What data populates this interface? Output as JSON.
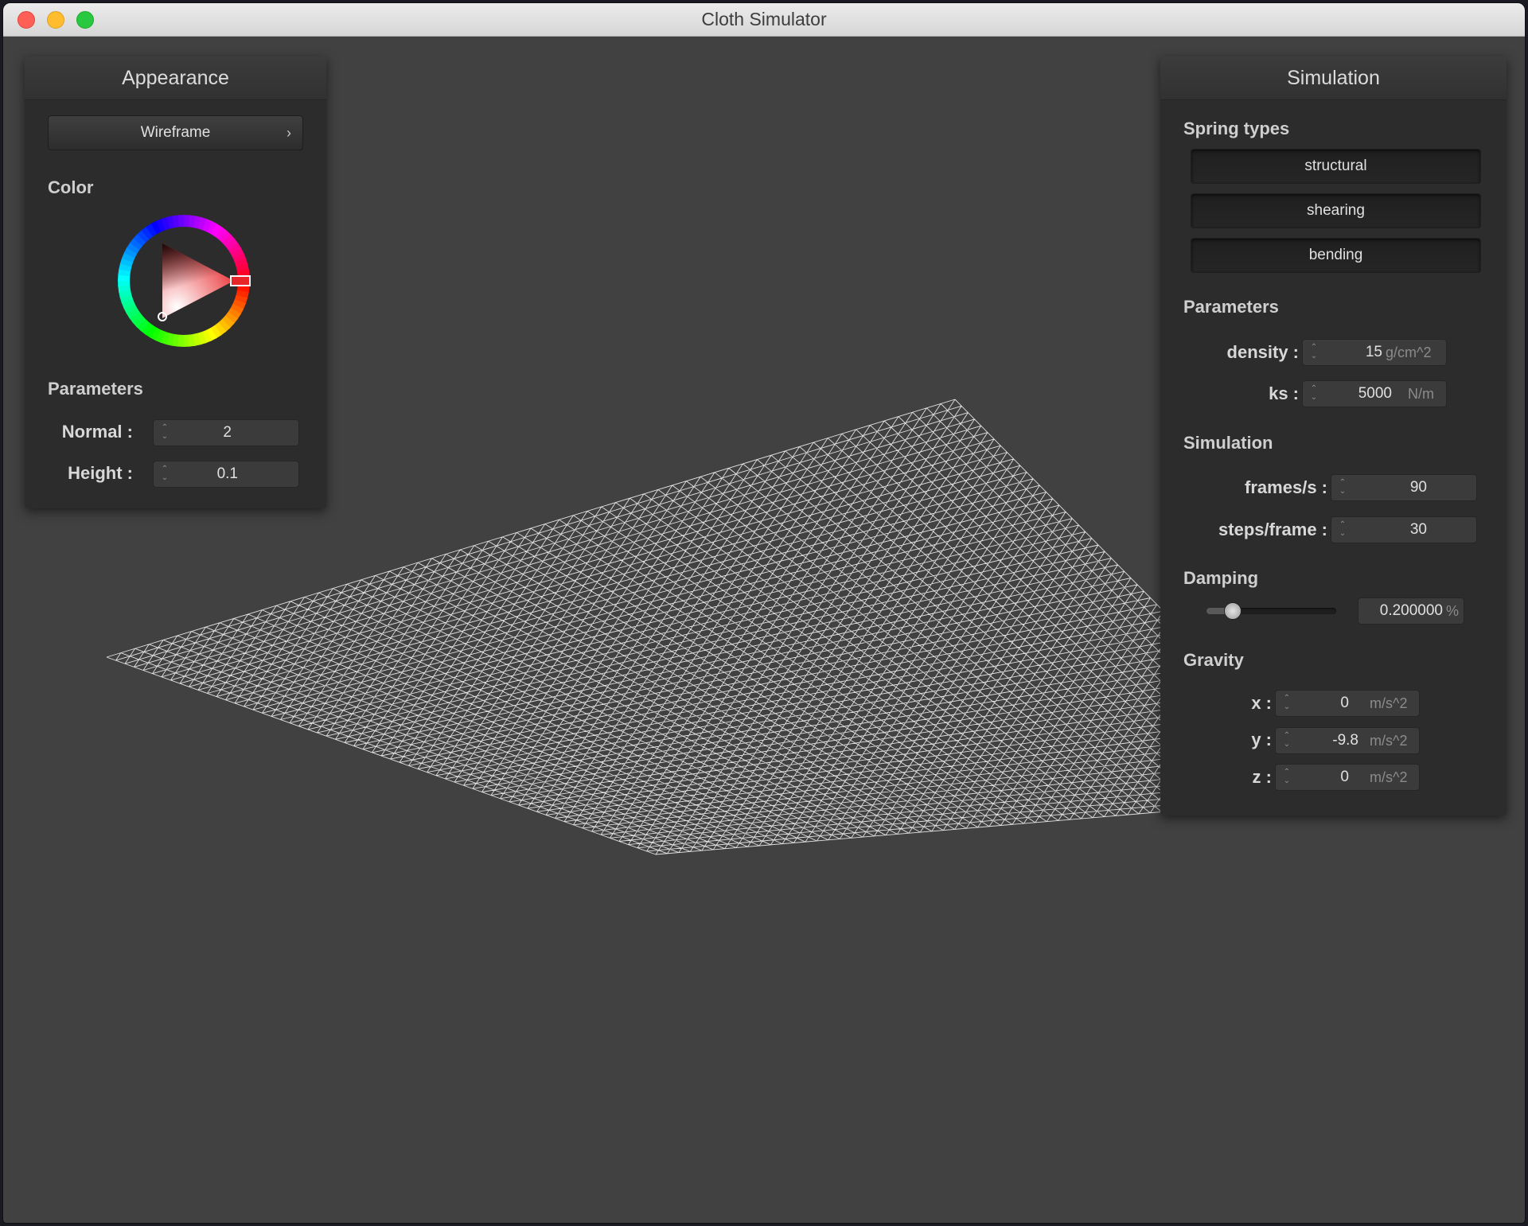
{
  "window": {
    "title": "Cloth Simulator"
  },
  "appearance": {
    "header": "Appearance",
    "render_mode": "Wireframe",
    "color_label": "Color",
    "selected_color": "#e8262a",
    "parameters_label": "Parameters",
    "normal": {
      "label": "Normal :",
      "value": "2"
    },
    "height": {
      "label": "Height :",
      "value": "0.1"
    }
  },
  "simulation": {
    "header": "Simulation",
    "spring_types_label": "Spring types",
    "spring_types": [
      "structural",
      "shearing",
      "bending"
    ],
    "parameters_label": "Parameters",
    "density": {
      "label": "density :",
      "value": "15",
      "unit": "g/cm^2"
    },
    "ks": {
      "label": "ks :",
      "value": "5000",
      "unit": "N/m"
    },
    "simulation_label": "Simulation",
    "frames_per_s": {
      "label": "frames/s :",
      "value": "90"
    },
    "steps_per_frame": {
      "label": "steps/frame :",
      "value": "30"
    },
    "damping_label": "Damping",
    "damping": {
      "value": "0.200000",
      "unit": "%",
      "slider_fraction": 0.2
    },
    "gravity_label": "Gravity",
    "gravity": {
      "x": {
        "label": "x :",
        "value": "0",
        "unit": "m/s^2"
      },
      "y": {
        "label": "y :",
        "value": "-9.8",
        "unit": "m/s^2"
      },
      "z": {
        "label": "z :",
        "value": "0",
        "unit": "m/s^2"
      }
    }
  },
  "scene": {
    "cloth_color": "#ffffff",
    "background": "#414141"
  }
}
